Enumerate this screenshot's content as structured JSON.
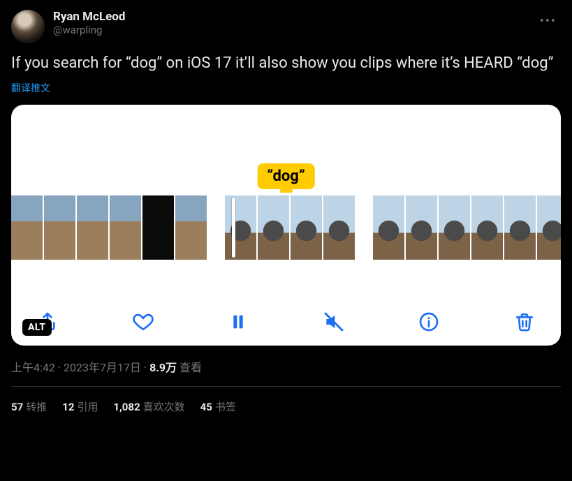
{
  "author": {
    "display_name": "Ryan McLeod",
    "handle": "@warpling"
  },
  "body": "If you search for “dog” on iOS 17 it’ll also show you clips where it’s HEARD “dog”",
  "translate_label": "翻译推文",
  "media": {
    "caption": "“dog”",
    "alt_badge": "ALT"
  },
  "meta": {
    "time": "上午4:42",
    "date": "2023年7月17日",
    "views_num": "8.9万",
    "views_label": "查看",
    "sep": " · "
  },
  "engagement": {
    "retweets": {
      "count": "57",
      "label": "转推"
    },
    "quotes": {
      "count": "12",
      "label": "引用"
    },
    "likes": {
      "count": "1,082",
      "label": "喜欢次数"
    },
    "bookmarks": {
      "count": "45",
      "label": "书签"
    }
  }
}
